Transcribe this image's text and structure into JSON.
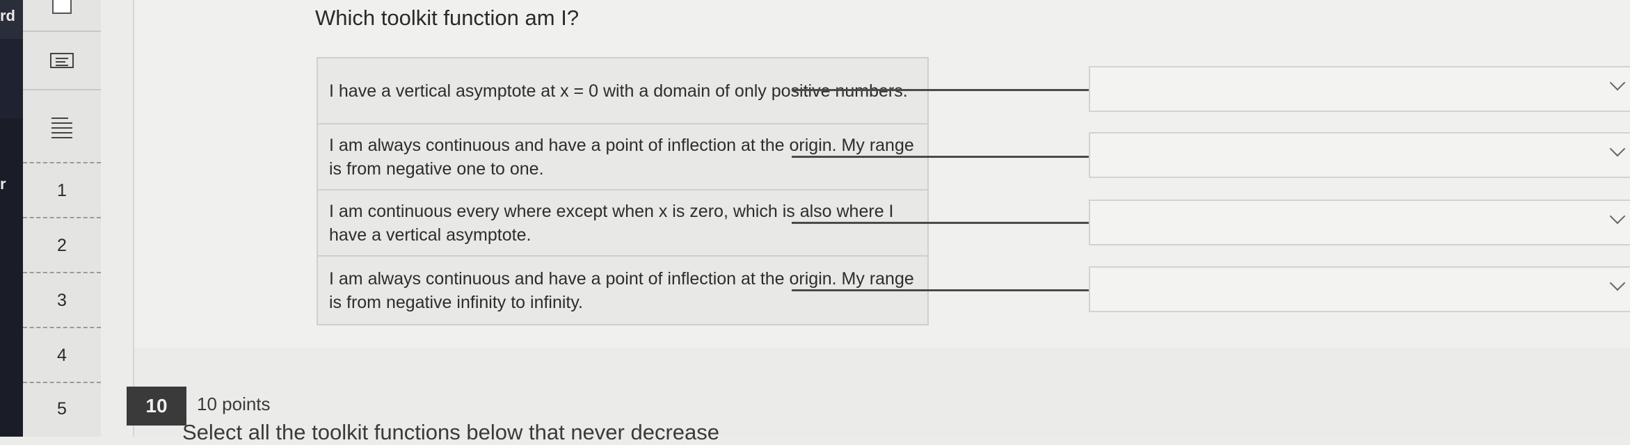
{
  "edge_labels": {
    "top": "rd",
    "mid": "r"
  },
  "question_nav": {
    "items": [
      "1",
      "2",
      "3",
      "4",
      "5"
    ]
  },
  "question": {
    "title": "Which toolkit function am I?",
    "prompts": [
      "I have a vertical asymptote at x = 0 with a domain of only positive numbers.",
      "I am always continuous and have a point of inflection at the origin. My range is from negative one to one.",
      "I am continuous every where except when x is zero, which is also where I have a vertical asymptote.",
      "I am always continuous and have a point of inflection at the origin. My range is from negative infinity to infinity."
    ],
    "answers": [
      "",
      "",
      "",
      ""
    ]
  },
  "next_question": {
    "number": "10",
    "points": "10 points",
    "partial_text": "Select all the toolkit functions below that never decrease"
  },
  "colors": {
    "badge": "#3a3a3a",
    "sidebar_dark": "#1f2230"
  }
}
